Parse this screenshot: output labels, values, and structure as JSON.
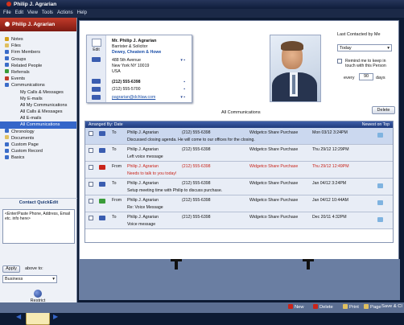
{
  "window": {
    "title": "Philip J. Agrarian"
  },
  "menu": [
    "File",
    "Edit",
    "View",
    "Tools",
    "Actions",
    "Help"
  ],
  "sidebar": {
    "header": "Philip J. Agrarian",
    "items": [
      {
        "label": "Notes",
        "color": "#d4a017"
      },
      {
        "label": "Files",
        "color": "#e0c060"
      },
      {
        "label": "Firm Members",
        "color": "#3a6cc9"
      },
      {
        "label": "Groups",
        "color": "#3a6cc9"
      },
      {
        "label": "Related People",
        "color": "#3a6cc9"
      },
      {
        "label": "Referrals",
        "color": "#3a9c3a"
      },
      {
        "label": "Events",
        "color": "#c23b2a"
      },
      {
        "label": "Communications",
        "color": "#3a6cc9"
      }
    ],
    "sub_items": [
      "My Calls & Messages",
      "My E-mails",
      "All My Communications",
      "All Calls & Messages",
      "All E-mails",
      "All Communications"
    ],
    "bottom_items": [
      {
        "label": "Chronology",
        "color": "#3a6cc9"
      },
      {
        "label": "Documents",
        "color": "#e0c060"
      },
      {
        "label": "Custom Page",
        "color": "#3a6cc9"
      },
      {
        "label": "Custom Record",
        "color": "#3a6cc9"
      },
      {
        "label": "Basics",
        "color": "#3a6cc9"
      }
    ],
    "quick": {
      "title": "Contact QuickEdit",
      "box_text": "<Enter/Paste Phone, Address, Email etc. info here>",
      "apply": "Apply",
      "above": "above to:",
      "select": "Business",
      "restrict": "Restrict"
    }
  },
  "card": {
    "edit": "Edit",
    "name": "Mr. Philip J. Agrarian",
    "title": "Barrister & Solicitor",
    "company": "Dewey, Cheatem & Howe",
    "addr1": "488 5th Avenue",
    "addr2": "New York NY 10019",
    "country": "USA",
    "phone1": "(212) 555-6398",
    "phone2": "(212) 555-5700",
    "email": "pagrarian@dchlaw.com"
  },
  "contacted": {
    "label": "Last Contacted by Me",
    "value": "Today",
    "remind": "Remind me to keep in touch with this Person",
    "every": "every",
    "days_value": "90",
    "days": "days"
  },
  "list_title": "All Communications",
  "delete": "Delete",
  "list": {
    "header_left": "Arranged By: Date",
    "header_right": "Newest on Top",
    "rows": [
      {
        "dir": "To",
        "name": "Philip J. Agrarian",
        "phone": "(212) 555-6398",
        "subject": "Widgetco Share Purchase",
        "date": "Mon 03/12 3:24PM",
        "desc": "Discussed closing agenda. He will come to our offices for the closing.",
        "icon_color": "#3a5db0",
        "red": false,
        "note": true
      },
      {
        "dir": "To",
        "name": "Philip J. Agrarian",
        "phone": "(212) 555-6398",
        "subject": "Widgetco Share Purchase",
        "date": "Thu 29/12 12:29PM",
        "desc": "Left voice message",
        "icon_color": "#3a5db0",
        "red": false,
        "note": false
      },
      {
        "dir": "From",
        "name": "Philip J. Agrarian",
        "phone": "(212) 555-6398",
        "subject": "Widgetco Share Purchase",
        "date": "Thu 29/12 12:49PM",
        "desc": "Needs to talk to you today!",
        "icon_color": "#c9241a",
        "red": true,
        "note": false
      },
      {
        "dir": "To",
        "name": "Philip J. Agrarian",
        "phone": "(212) 555-6398",
        "subject": "Widgetco Share Purchase",
        "date": "Jan 04/12 3:24PM",
        "desc": "Setup meeting time with Philip to discuss purchase.",
        "icon_color": "#3a5db0",
        "red": false,
        "note": true
      },
      {
        "dir": "From",
        "name": "Philip J. Agrarian",
        "phone": "(212) 555-6398",
        "subject": "Widgetco Share Purchase",
        "date": "Jan 04/12 10:44AM",
        "desc": "Re: Voice Message",
        "icon_color": "#3a9c3a",
        "red": false,
        "note": true
      },
      {
        "dir": "To",
        "name": "Philip J. Agrarian",
        "phone": "(212) 555-6398",
        "subject": "Widgetco Share Purchase",
        "date": "Dec 20/11 4:32PM",
        "desc": "Voice message",
        "icon_color": "#3a5db0",
        "red": false,
        "note": true
      }
    ]
  },
  "bottom": {
    "new": "New",
    "delete": "Delete",
    "print": "Print",
    "page": "Page",
    "save": "Save & Cl"
  }
}
